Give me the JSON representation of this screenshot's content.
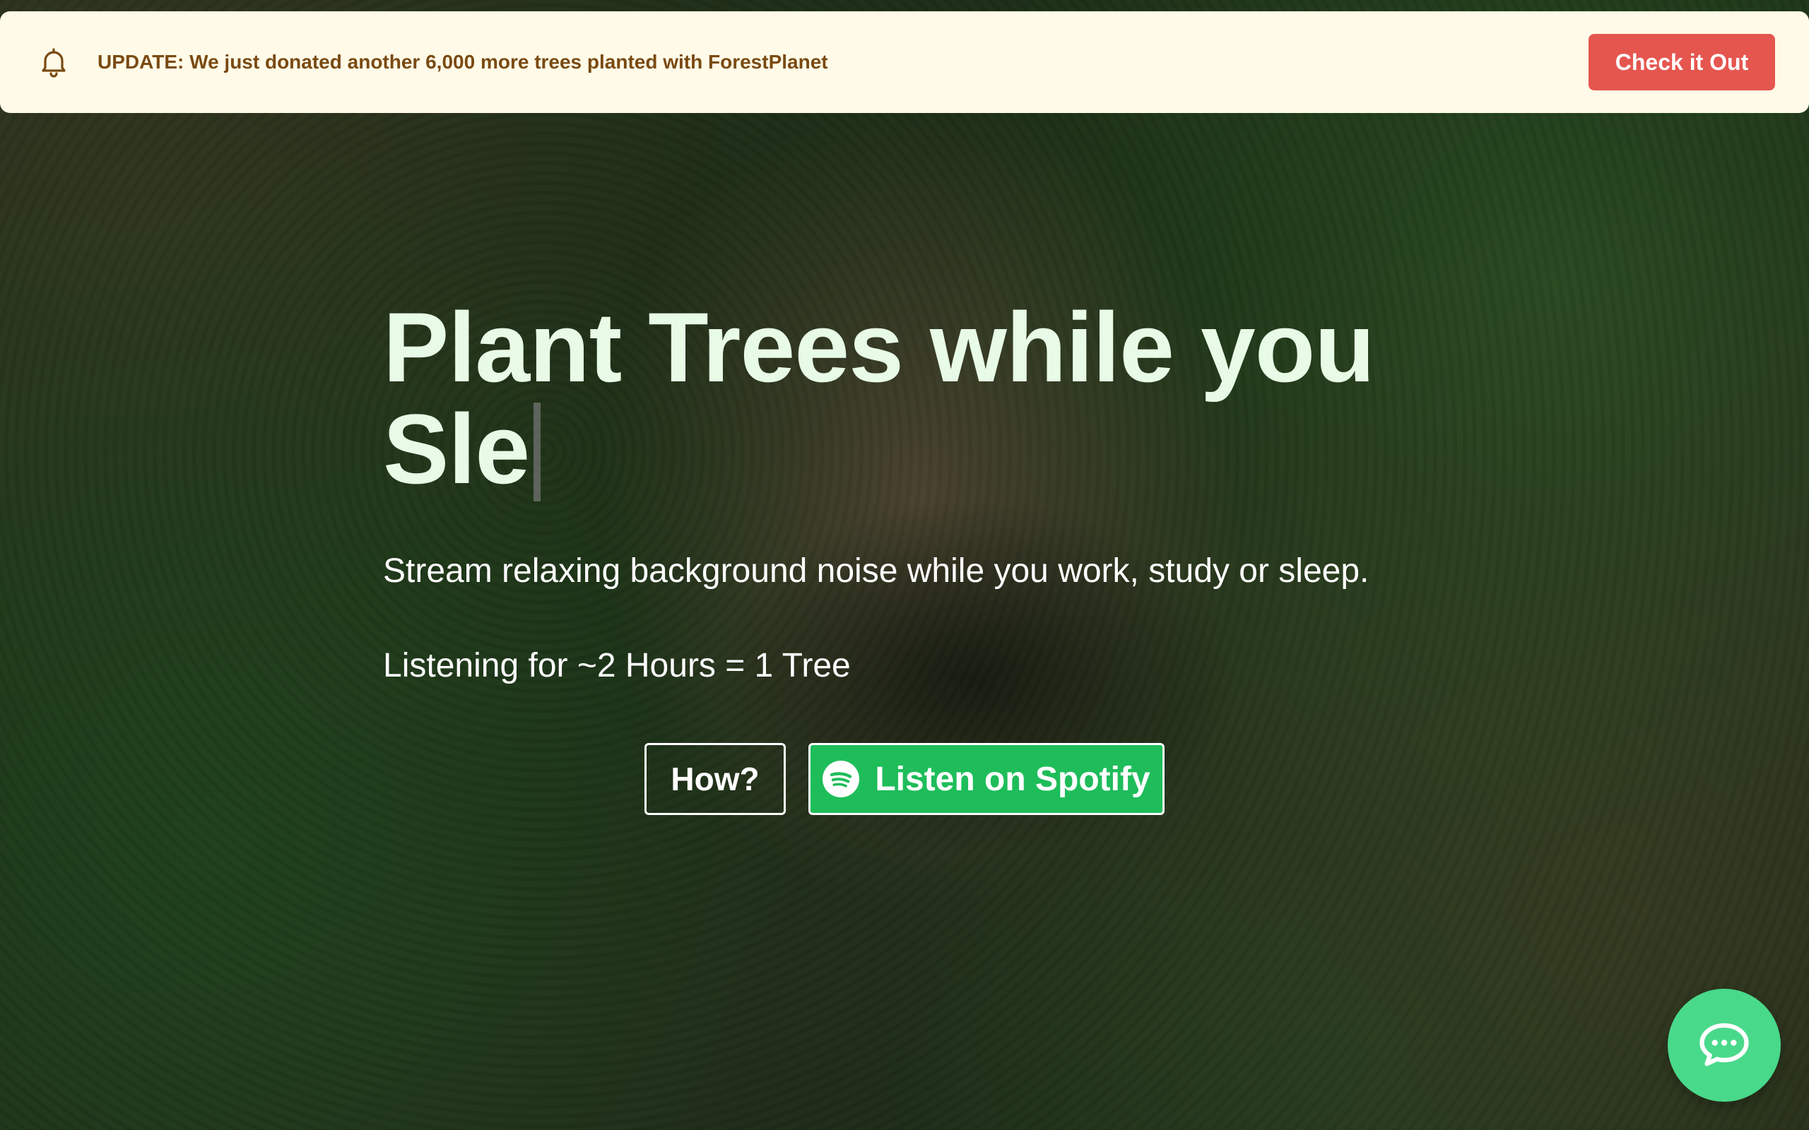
{
  "banner": {
    "message": "UPDATE: We just donated another 6,000 more trees planted with ForestPlanet",
    "cta_label": "Check it Out",
    "icon": "bell-icon"
  },
  "hero": {
    "title": "Plant Trees while you Sle",
    "subtitle": "Stream relaxing background noise while you work, study or sleep.",
    "rate": "Listening for ~2 Hours = 1 Tree",
    "how_label": "How?",
    "spotify_label": "Listen on Spotify"
  },
  "chat": {
    "icon": "chat-bubble-icon"
  },
  "colors": {
    "banner_bg": "#fffbe8",
    "banner_text": "#7a4a12",
    "cta_bg": "#e5564f",
    "title": "#e8fbe6",
    "spotify_green": "#1ebd5a",
    "chat_green": "#49d98a"
  }
}
